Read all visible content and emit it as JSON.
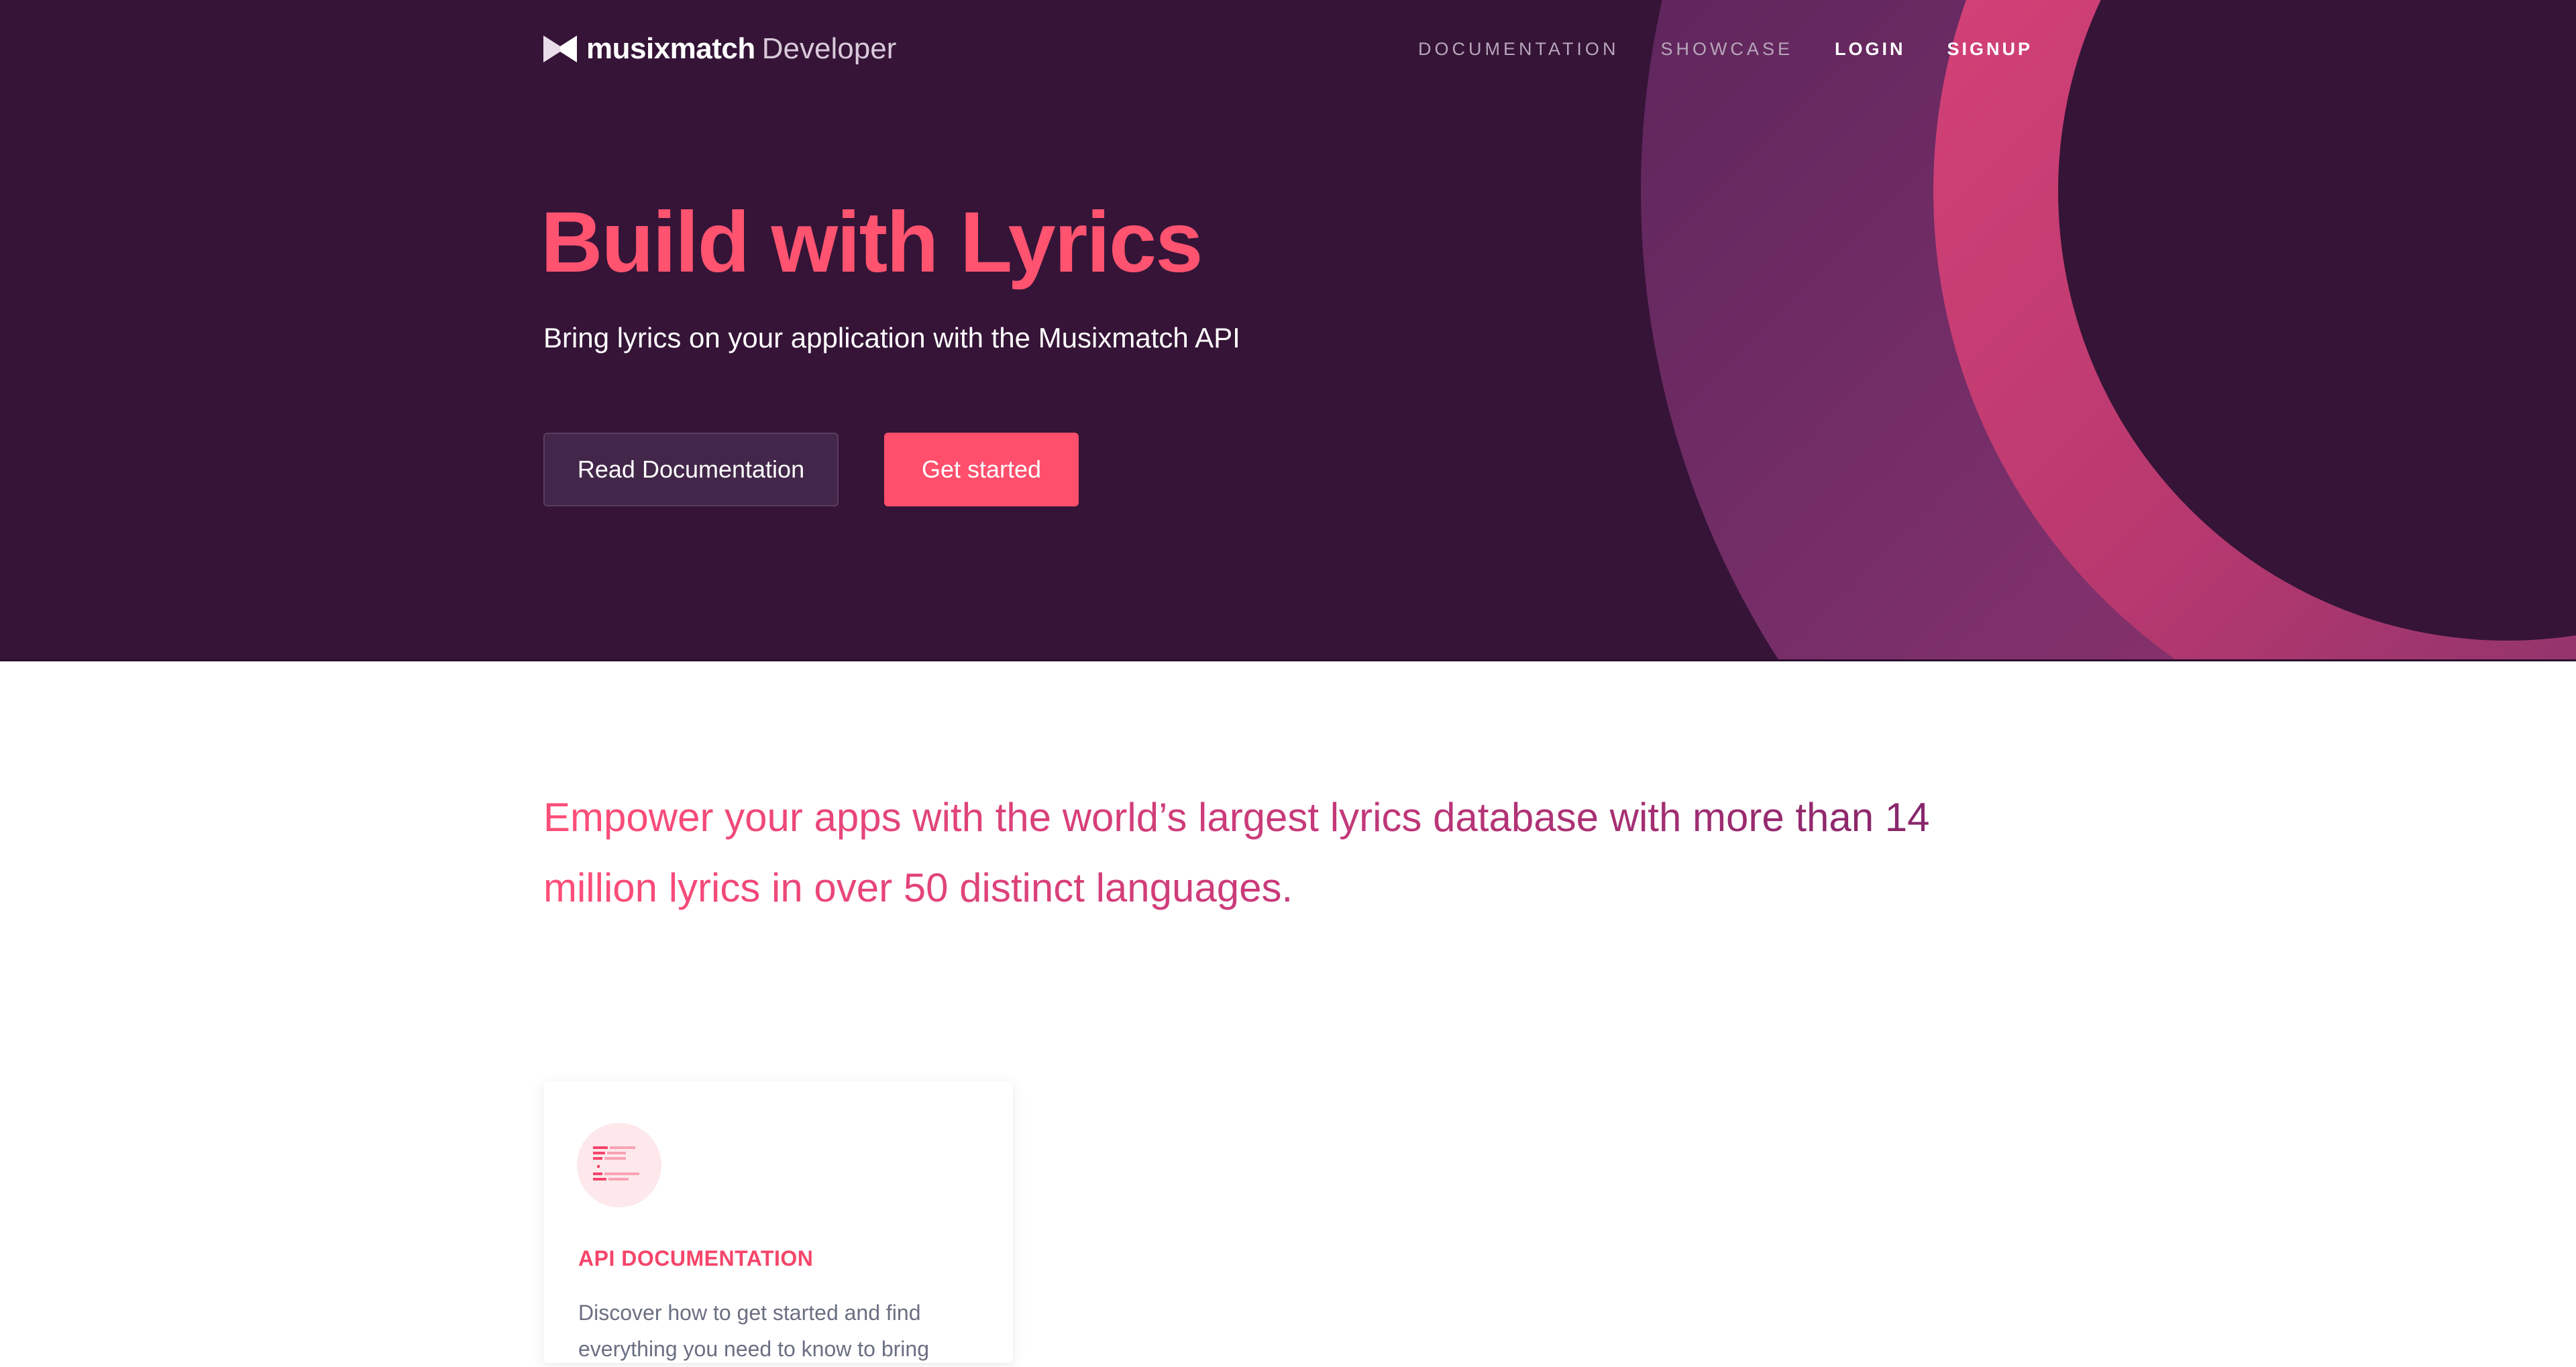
{
  "brand": {
    "name": "musixmatch",
    "suffix": "Developer"
  },
  "nav": {
    "items": [
      "DOCUMENTATION",
      "SHOWCASE",
      "LOGIN",
      "SIGNUP"
    ]
  },
  "hero": {
    "title": "Build with Lyrics",
    "subtitle": "Bring lyrics on your application with the Musixmatch API",
    "primary_button": "Get started",
    "secondary_button": "Read Documentation"
  },
  "intro": {
    "text": "Empower your apps with the world’s largest lyrics database with more than 14 million lyrics in over 50 distinct languages."
  },
  "cards": [
    {
      "icon": "document-icon",
      "title": "API DOCUMENTATION",
      "description": "Discover how to get started and find everything you need to know to bring"
    }
  ],
  "colors": {
    "hero_bg": "#351437",
    "accent": "#ff5370",
    "button_primary": "#ff4f6c",
    "button_secondary": "#43274a",
    "text_muted": "#6a6f82"
  }
}
